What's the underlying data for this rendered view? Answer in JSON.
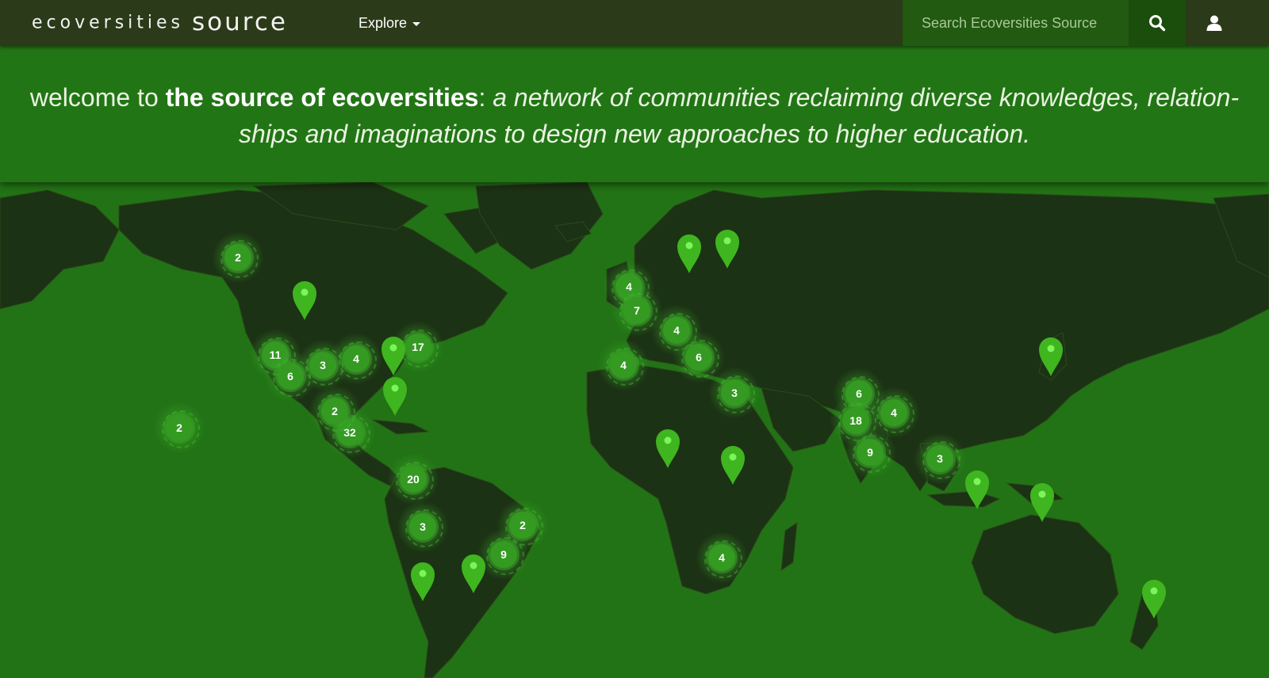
{
  "navbar": {
    "logo_light": "ecoversities",
    "logo_bold": "source",
    "explore_label": "Explore",
    "search_placeholder": "Search Ecoversities Source",
    "search_icon": "search-icon",
    "user_icon": "user-icon"
  },
  "banner": {
    "prefix": "welcome to ",
    "highlight": "the source of ecoversities",
    "colon": ": ",
    "tagline": "a network of communities reclaiming diverse knowledges, relation-ships and imaginations to design new approaches to higher education."
  },
  "colors": {
    "navbar": "#2b3a18",
    "banner": "#227515",
    "ocean": "#227315",
    "land": "#1c3214",
    "marker": "#3fb51f",
    "marker_center": "#7af55a"
  },
  "map": {
    "clusters": [
      {
        "label": "2"
      },
      {
        "label": "11"
      },
      {
        "label": "6"
      },
      {
        "label": "3"
      },
      {
        "label": "4"
      },
      {
        "label": "17"
      },
      {
        "label": "2"
      },
      {
        "label": "32"
      },
      {
        "label": "2"
      },
      {
        "label": "20"
      },
      {
        "label": "3"
      },
      {
        "label": "2"
      },
      {
        "label": "9"
      },
      {
        "label": "4"
      },
      {
        "label": "7"
      },
      {
        "label": "4"
      },
      {
        "label": "4"
      },
      {
        "label": "6"
      },
      {
        "label": "3"
      },
      {
        "label": "6"
      },
      {
        "label": "18"
      },
      {
        "label": "4"
      },
      {
        "label": "9"
      },
      {
        "label": "3"
      },
      {
        "label": "4"
      }
    ],
    "pins_count": 14
  }
}
